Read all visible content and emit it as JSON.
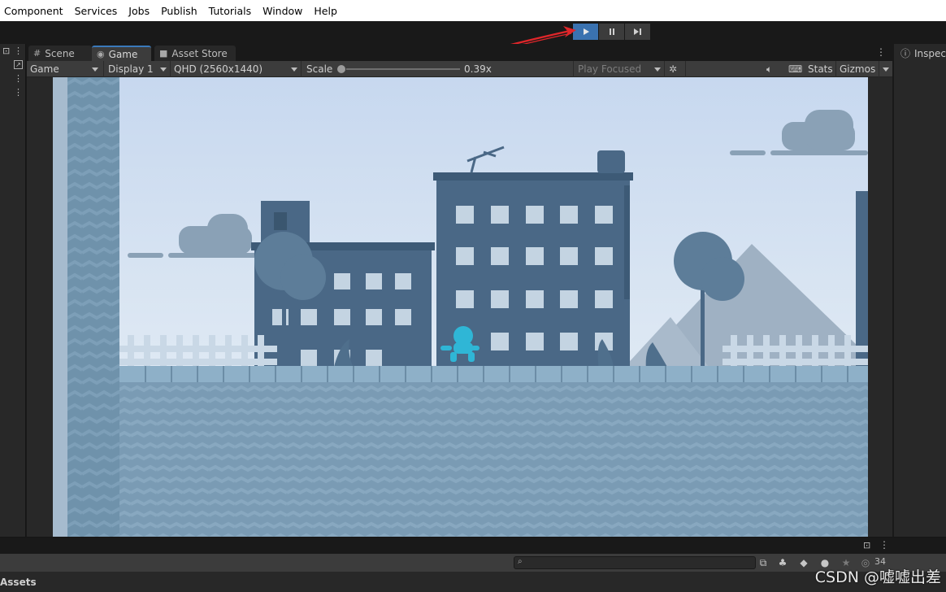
{
  "menu": [
    "Component",
    "Services",
    "Jobs",
    "Publish",
    "Tutorials",
    "Window",
    "Help"
  ],
  "playmode": {
    "play_icon": "play-icon",
    "pause_icon": "pause-icon",
    "step_icon": "step-icon",
    "accent": "#3a72b0",
    "annotation_color": "#e0262a"
  },
  "left_panel": {
    "icons": [
      "lock-icon",
      "kebab-icon",
      "maximize-icon",
      "kebab-icon"
    ]
  },
  "tabs": [
    {
      "label": "Scene",
      "icon": "grid-icon"
    },
    {
      "label": "Game",
      "icon": "gamepad-icon"
    },
    {
      "label": "Asset Store",
      "icon": "bag-icon"
    }
  ],
  "game_toolbar": {
    "view_mode": "Game",
    "display": "Display 1",
    "resolution": "QHD (2560x1440)",
    "scale_label": "Scale",
    "scale_value": "0.39x",
    "scale_fraction": 0.0,
    "play_focused": "Play Focused",
    "stats": "Stats",
    "gizmos": "Gizmos"
  },
  "inspector": {
    "label": "Inspect",
    "icon": "info-icon"
  },
  "project": {
    "assets_label": "Assets",
    "search_placeholder": "",
    "hidden_count": "34"
  },
  "watermark": "CSDN @嘘嘘出差"
}
